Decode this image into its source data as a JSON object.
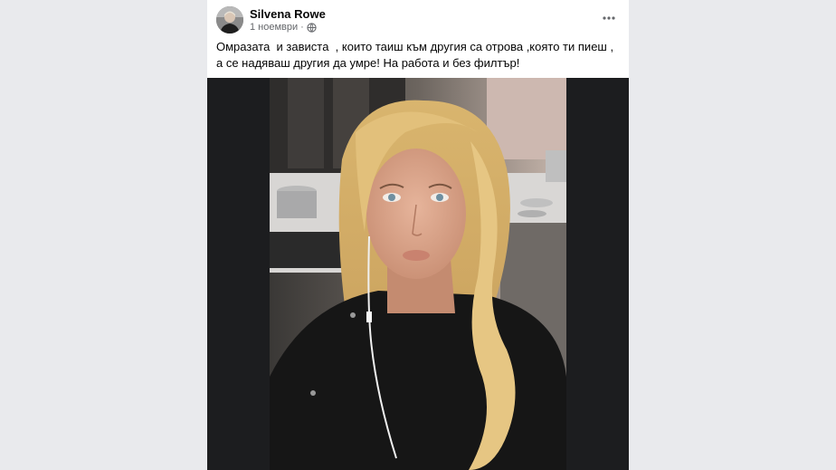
{
  "post": {
    "author": "Silvena Rowe",
    "date": "1 ноември",
    "separator": "·",
    "text": "Омразата  и завистa  , които таиш към другия са отрова ,която ти пиеш , а се надяваш другия да умре! На работа и без филтър!",
    "avatar_icon": "person-photo-icon",
    "privacy_icon": "globe-icon",
    "menu_icon": "more-horizontal-icon"
  },
  "colors": {
    "background": "#e9eaed",
    "card": "#ffffff",
    "text": "#050505",
    "secondary_text": "#65676b",
    "media_letterbox": "#1c1d1f"
  }
}
